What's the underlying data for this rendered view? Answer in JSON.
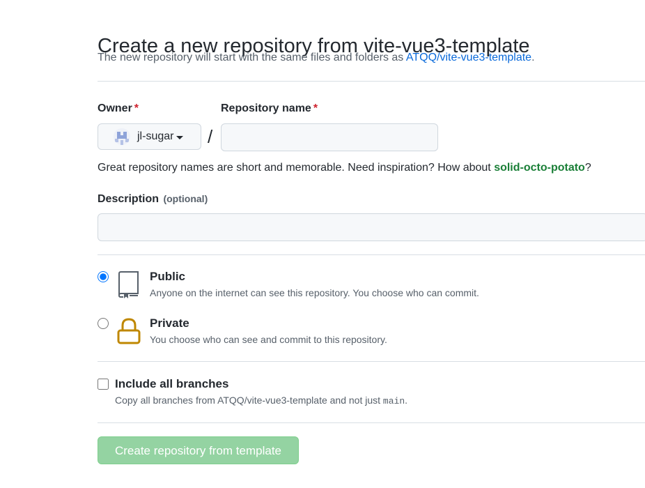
{
  "page": {
    "title": "Create a new repository from vite-vue3-template",
    "subtitle_prefix": "The new repository will start with the same files and folders as",
    "template_link": "ATQQ/vite-vue3-template",
    "subtitle_suffix": "."
  },
  "form": {
    "owner": {
      "label": "Owner",
      "required_marker": "*",
      "selected": "jl-sugar"
    },
    "separator": "/",
    "repository_name": {
      "label": "Repository name",
      "required_marker": "*",
      "value": "",
      "placeholder": ""
    },
    "inspiration": {
      "prefix": "Great repository names are short and memorable. Need inspiration? How about",
      "suggestion": "solid-octo-potato",
      "suffix": "?"
    },
    "description": {
      "label": "Description",
      "optional_text": "(optional)",
      "value": "",
      "placeholder": ""
    },
    "visibility": {
      "public": {
        "title": "Public",
        "description": "Anyone on the internet can see this repository. You choose who can commit.",
        "selected": true,
        "icon": "repo-icon"
      },
      "private": {
        "title": "Private",
        "description": "You choose who can see and commit to this repository.",
        "selected": false,
        "icon": "lock-icon"
      }
    },
    "include_branches": {
      "title": "Include all branches",
      "description_prefix": "Copy all branches from ATQQ/vite-vue3-template and not just",
      "branch": "main",
      "description_suffix": ".",
      "checked": false
    },
    "submit": {
      "label": "Create repository from template",
      "disabled": true
    }
  },
  "colors": {
    "link": "#0969da",
    "suggestion": "#1a7f37",
    "required": "#cf222e",
    "lock": "#bf8700",
    "submit_disabled": "#94d3a2"
  }
}
